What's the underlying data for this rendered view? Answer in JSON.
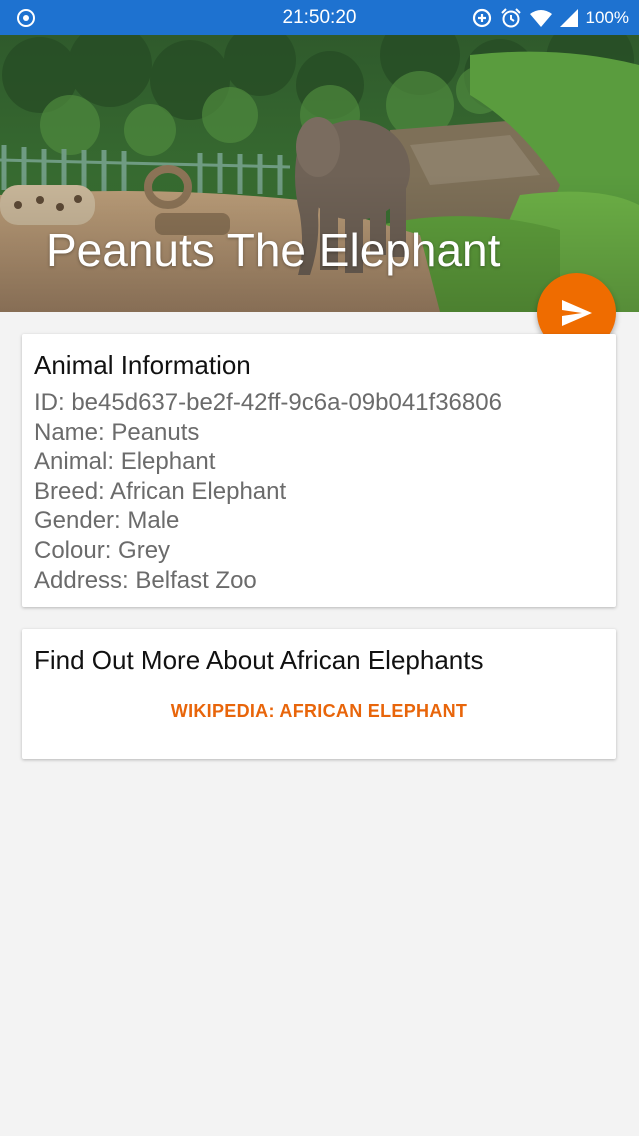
{
  "status_bar": {
    "time": "21:50:20",
    "battery": "100%",
    "icons": [
      "record-icon",
      "data-saver-icon",
      "alarm-icon",
      "wifi-icon",
      "signal-icon",
      "battery-icon"
    ],
    "background": "#1e72d0"
  },
  "header": {
    "title": "Peanuts The Elephant"
  },
  "fab": {
    "icon": "send-icon",
    "color": "#ef6c00"
  },
  "info_card": {
    "title": "Animal Information",
    "lines": [
      "ID: be45d637-be2f-42ff-9c6a-09b041f36806",
      "Name: Peanuts",
      "Animal: Elephant",
      "Breed: African Elephant",
      "Gender: Male",
      "Colour: Grey",
      "Address: Belfast Zoo"
    ]
  },
  "more_card": {
    "title": "Find Out More About African Elephants",
    "link_label": "WIKIPEDIA: AFRICAN ELEPHANT",
    "link_color": "#e8650a"
  }
}
